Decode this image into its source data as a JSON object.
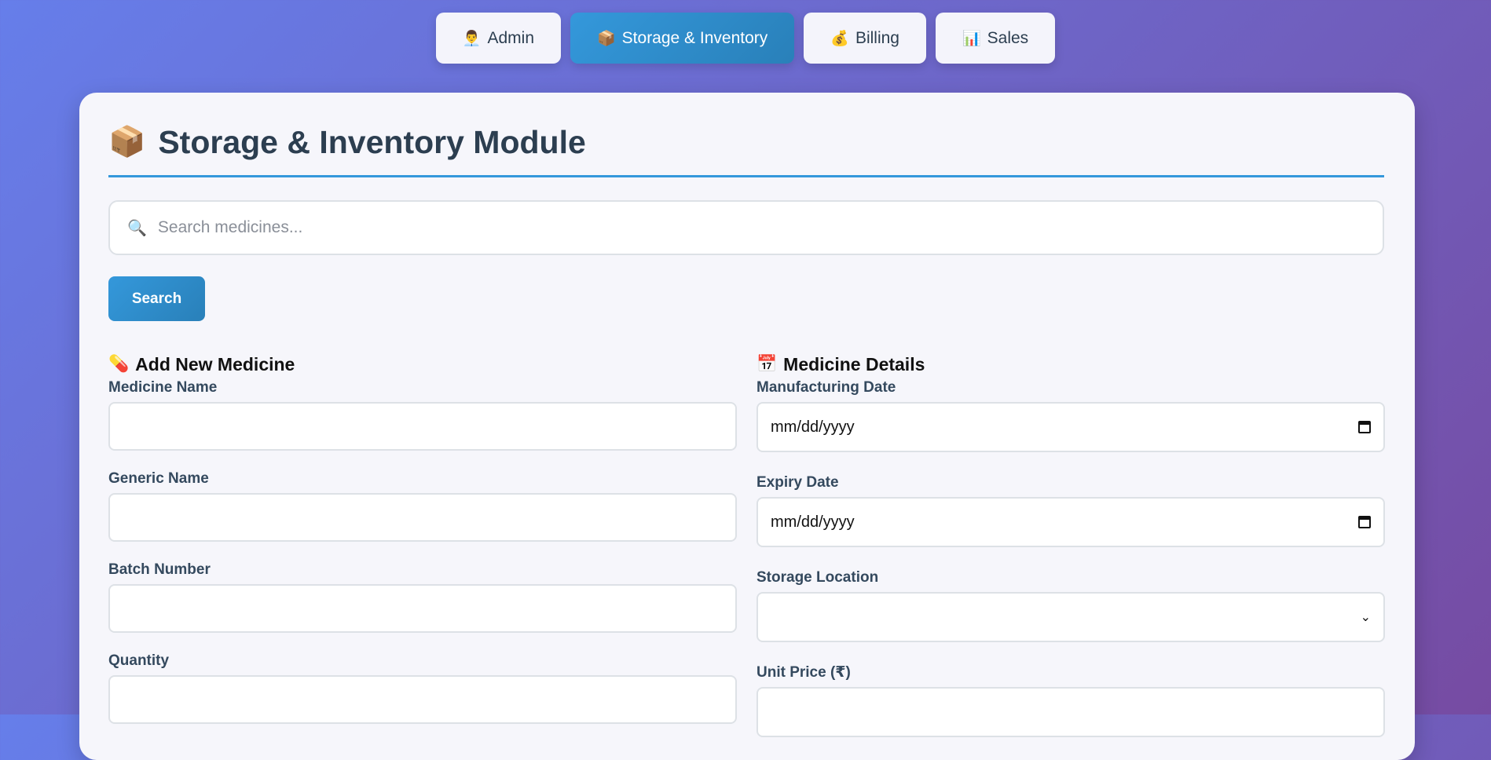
{
  "nav": {
    "tabs": [
      {
        "icon": "👨‍💼",
        "label": "Admin",
        "active": false
      },
      {
        "icon": "📦",
        "label": "Storage & Inventory",
        "active": true
      },
      {
        "icon": "💰",
        "label": "Billing",
        "active": false
      },
      {
        "icon": "📊",
        "label": "Sales",
        "active": false
      }
    ]
  },
  "page": {
    "title_icon": "📦",
    "title": "Storage & Inventory Module"
  },
  "search": {
    "icon": "🔍",
    "placeholder": "Search medicines...",
    "button_label": "Search"
  },
  "add_medicine": {
    "icon": "💊",
    "title": "Add New Medicine",
    "fields": [
      {
        "label": "Medicine Name",
        "value": ""
      },
      {
        "label": "Generic Name",
        "value": ""
      },
      {
        "label": "Batch Number",
        "value": ""
      },
      {
        "label": "Quantity",
        "value": ""
      }
    ]
  },
  "medicine_details": {
    "icon": "📅",
    "title": "Medicine Details",
    "manufacturing_date": {
      "label": "Manufacturing Date",
      "value": "mm/dd/yyyy"
    },
    "expiry_date": {
      "label": "Expiry Date",
      "value": "mm/dd/yyyy"
    },
    "storage_location": {
      "label": "Storage Location",
      "value": ""
    },
    "unit_price": {
      "label": "Unit Price (₹)",
      "value": ""
    }
  },
  "colors": {
    "accent": "#3498db",
    "background_start": "#667eea",
    "background_end": "#764ba2",
    "text": "#2c3e50"
  }
}
